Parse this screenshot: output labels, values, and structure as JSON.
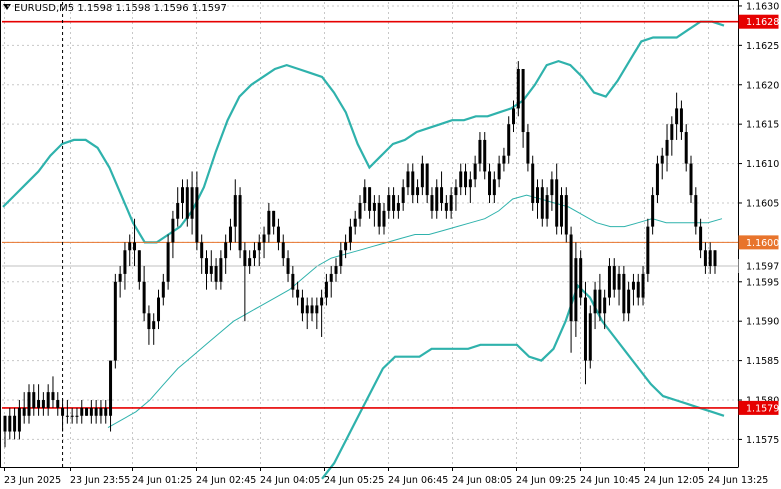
{
  "header": {
    "symbol": "EURUSD,M5",
    "ohlc": "1.1598 1.1598 1.1596 1.1597"
  },
  "chart_data": {
    "type": "candlestick",
    "ylim": [
      1.15715,
      1.16305
    ],
    "y_ticks": [
      "1.1630",
      "1.1625",
      "1.1620",
      "1.1615",
      "1.1610",
      "1.1605",
      "1.1600",
      "1.1595",
      "1.1590",
      "1.1585",
      "1.1580",
      "1.1575"
    ],
    "x_ticks": [
      "23 Jun 2025",
      "23 Jun 23:55",
      "24 Jun 01:25",
      "24 Jun 02:45",
      "24 Jun 04:05",
      "24 Jun 05:25",
      "24 Jun 06:45",
      "24 Jun 08:05",
      "24 Jun 09:25",
      "24 Jun 10:45",
      "24 Jun 12:05",
      "24 Jun 13:25"
    ],
    "grid": true,
    "horizontal_levels": [
      {
        "label": "1.1628",
        "value": 1.1628,
        "color": "#e60000",
        "badge_bg": "#e60000",
        "badge_fg": "#ffffff"
      },
      {
        "label": "1.1600",
        "value": 1.16,
        "color": "#e8742c",
        "badge_bg": "#e8742c",
        "badge_fg": "#ffffff"
      },
      {
        "label": "1.1597",
        "value": 1.1597,
        "color": "#c0c0c0",
        "badge_bg": "#ffffff",
        "badge_fg": "#000000"
      },
      {
        "label": "1.1579",
        "value": 1.1579,
        "color": "#e60000",
        "badge_bg": "#e60000",
        "badge_fg": "#ffffff"
      }
    ],
    "vertical_marker_index": 12,
    "colors": {
      "candle": "#000000",
      "band": "#2fb2ac",
      "mid": "#3cc0c0",
      "grid": "#c8c8c8",
      "axis": "#000000"
    },
    "candles": [
      [
        1.1578,
        1.1578,
        1.1574,
        1.1576
      ],
      [
        1.1576,
        1.1579,
        1.1575,
        1.1578
      ],
      [
        1.1578,
        1.1579,
        1.1575,
        1.1576
      ],
      [
        1.1576,
        1.158,
        1.1575,
        1.1579
      ],
      [
        1.1579,
        1.1581,
        1.1577,
        1.1578
      ],
      [
        1.1578,
        1.1582,
        1.1577,
        1.1581
      ],
      [
        1.1581,
        1.1582,
        1.1578,
        1.1579
      ],
      [
        1.1579,
        1.1582,
        1.1578,
        1.158
      ],
      [
        1.158,
        1.1581,
        1.1578,
        1.1579
      ],
      [
        1.1579,
        1.1582,
        1.1578,
        1.1581
      ],
      [
        1.1581,
        1.1583,
        1.1579,
        1.158
      ],
      [
        1.158,
        1.1581,
        1.1578,
        1.1579
      ],
      [
        1.1579,
        1.158,
        1.1576,
        1.1578
      ],
      [
        1.1578,
        1.158,
        1.1577,
        1.1578
      ],
      [
        1.1578,
        1.1579,
        1.1577,
        1.1578
      ],
      [
        1.1578,
        1.1579,
        1.1577,
        1.1578
      ],
      [
        1.1578,
        1.158,
        1.1577,
        1.1579
      ],
      [
        1.1579,
        1.1579,
        1.1578,
        1.1578
      ],
      [
        1.1578,
        1.158,
        1.1577,
        1.1579
      ],
      [
        1.1579,
        1.158,
        1.1577,
        1.1578
      ],
      [
        1.1578,
        1.158,
        1.1577,
        1.1579
      ],
      [
        1.1579,
        1.158,
        1.1577,
        1.1578
      ],
      [
        1.1578,
        1.1585,
        1.1576,
        1.1585
      ],
      [
        1.1585,
        1.1596,
        1.1584,
        1.1595
      ],
      [
        1.1595,
        1.1597,
        1.1593,
        1.1596
      ],
      [
        1.1596,
        1.16,
        1.1594,
        1.1599
      ],
      [
        1.1599,
        1.1601,
        1.1597,
        1.16
      ],
      [
        1.16,
        1.1603,
        1.1597,
        1.1599
      ],
      [
        1.1599,
        1.1599,
        1.1594,
        1.1595
      ],
      [
        1.1595,
        1.1597,
        1.159,
        1.1591
      ],
      [
        1.1591,
        1.1592,
        1.1587,
        1.1589
      ],
      [
        1.1589,
        1.1591,
        1.1587,
        1.159
      ],
      [
        1.159,
        1.1594,
        1.1589,
        1.1593
      ],
      [
        1.1593,
        1.1596,
        1.1592,
        1.1595
      ],
      [
        1.1595,
        1.1601,
        1.1594,
        1.16
      ],
      [
        1.16,
        1.1604,
        1.1598,
        1.1603
      ],
      [
        1.1603,
        1.1607,
        1.1602,
        1.1605
      ],
      [
        1.1605,
        1.1608,
        1.1603,
        1.1607
      ],
      [
        1.1607,
        1.1608,
        1.1602,
        1.1603
      ],
      [
        1.1603,
        1.1609,
        1.1601,
        1.1607
      ],
      [
        1.1607,
        1.1609,
        1.1599,
        1.16
      ],
      [
        1.16,
        1.1601,
        1.1596,
        1.1598
      ],
      [
        1.1598,
        1.1599,
        1.1594,
        1.1596
      ],
      [
        1.1596,
        1.1599,
        1.1595,
        1.1597
      ],
      [
        1.1597,
        1.1598,
        1.1594,
        1.1595
      ],
      [
        1.1595,
        1.1599,
        1.1594,
        1.1598
      ],
      [
        1.1598,
        1.1601,
        1.1596,
        1.16
      ],
      [
        1.16,
        1.1603,
        1.1599,
        1.1602
      ],
      [
        1.1602,
        1.1608,
        1.16,
        1.1606
      ],
      [
        1.1606,
        1.1607,
        1.1598,
        1.1599
      ],
      [
        1.1599,
        1.16,
        1.159,
        1.1597
      ],
      [
        1.1597,
        1.1599,
        1.1596,
        1.1598
      ],
      [
        1.1598,
        1.16,
        1.1597,
        1.1599
      ],
      [
        1.1599,
        1.1601,
        1.1597,
        1.16
      ],
      [
        1.16,
        1.1602,
        1.1598,
        1.1601
      ],
      [
        1.1601,
        1.1605,
        1.16,
        1.1604
      ],
      [
        1.1604,
        1.1604,
        1.1601,
        1.1602
      ],
      [
        1.1602,
        1.1603,
        1.1599,
        1.16
      ],
      [
        1.16,
        1.1601,
        1.1597,
        1.1598
      ],
      [
        1.1598,
        1.1599,
        1.1595,
        1.1596
      ],
      [
        1.1596,
        1.1597,
        1.1593,
        1.1594
      ],
      [
        1.1594,
        1.1595,
        1.1592,
        1.1593
      ],
      [
        1.1593,
        1.1594,
        1.159,
        1.1591
      ],
      [
        1.1591,
        1.1593,
        1.1589,
        1.1592
      ],
      [
        1.1592,
        1.1593,
        1.159,
        1.1591
      ],
      [
        1.1591,
        1.1593,
        1.1589,
        1.1592
      ],
      [
        1.1592,
        1.1594,
        1.1588,
        1.1593
      ],
      [
        1.1593,
        1.1596,
        1.1592,
        1.1595
      ],
      [
        1.1595,
        1.1597,
        1.1593,
        1.1596
      ],
      [
        1.1596,
        1.1598,
        1.1595,
        1.1597
      ],
      [
        1.1597,
        1.16,
        1.1596,
        1.1599
      ],
      [
        1.1599,
        1.1601,
        1.1598,
        1.16
      ],
      [
        1.16,
        1.1603,
        1.1599,
        1.1602
      ],
      [
        1.1602,
        1.1604,
        1.1601,
        1.1603
      ],
      [
        1.1603,
        1.1606,
        1.1602,
        1.1605
      ],
      [
        1.1605,
        1.1608,
        1.1604,
        1.1607
      ],
      [
        1.1607,
        1.1607,
        1.1603,
        1.1604
      ],
      [
        1.1604,
        1.1606,
        1.1602,
        1.1605
      ],
      [
        1.1605,
        1.1606,
        1.1601,
        1.1602
      ],
      [
        1.1602,
        1.1605,
        1.1601,
        1.1604
      ],
      [
        1.1604,
        1.1607,
        1.1603,
        1.1606
      ],
      [
        1.1606,
        1.1607,
        1.1603,
        1.1604
      ],
      [
        1.1604,
        1.1606,
        1.1603,
        1.1605
      ],
      [
        1.1605,
        1.1608,
        1.1604,
        1.1607
      ],
      [
        1.1607,
        1.161,
        1.1606,
        1.1609
      ],
      [
        1.1609,
        1.161,
        1.1605,
        1.1606
      ],
      [
        1.1606,
        1.1608,
        1.1605,
        1.1607
      ],
      [
        1.1607,
        1.1611,
        1.1606,
        1.161
      ],
      [
        1.161,
        1.161,
        1.1605,
        1.1606
      ],
      [
        1.1606,
        1.1607,
        1.1603,
        1.1604
      ],
      [
        1.1604,
        1.1608,
        1.1603,
        1.1607
      ],
      [
        1.1607,
        1.1609,
        1.1604,
        1.1605
      ],
      [
        1.1605,
        1.1606,
        1.1603,
        1.1604
      ],
      [
        1.1604,
        1.1607,
        1.1603,
        1.1606
      ],
      [
        1.1606,
        1.1608,
        1.1604,
        1.1607
      ],
      [
        1.1607,
        1.161,
        1.1606,
        1.1609
      ],
      [
        1.1609,
        1.161,
        1.1606,
        1.1607
      ],
      [
        1.1607,
        1.1609,
        1.1605,
        1.1608
      ],
      [
        1.1608,
        1.1611,
        1.1607,
        1.161
      ],
      [
        1.161,
        1.1614,
        1.1609,
        1.1613
      ],
      [
        1.1613,
        1.1614,
        1.1608,
        1.1609
      ],
      [
        1.1609,
        1.161,
        1.1605,
        1.1606
      ],
      [
        1.1606,
        1.1609,
        1.1605,
        1.1608
      ],
      [
        1.1608,
        1.1611,
        1.1607,
        1.161
      ],
      [
        1.161,
        1.1612,
        1.1609,
        1.1611
      ],
      [
        1.1611,
        1.1616,
        1.161,
        1.1615
      ],
      [
        1.1615,
        1.1618,
        1.1614,
        1.1617
      ],
      [
        1.1617,
        1.1623,
        1.1616,
        1.1622
      ],
      [
        1.1622,
        1.1622,
        1.1612,
        1.1614
      ],
      [
        1.1614,
        1.1615,
        1.1609,
        1.161
      ],
      [
        1.161,
        1.1611,
        1.1604,
        1.1605
      ],
      [
        1.1605,
        1.1608,
        1.1603,
        1.1607
      ],
      [
        1.1607,
        1.1608,
        1.1602,
        1.1603
      ],
      [
        1.1603,
        1.1607,
        1.1602,
        1.1606
      ],
      [
        1.1606,
        1.1609,
        1.1604,
        1.1608
      ],
      [
        1.1608,
        1.161,
        1.1601,
        1.1602
      ],
      [
        1.1602,
        1.1607,
        1.1601,
        1.1606
      ],
      [
        1.1606,
        1.1607,
        1.16,
        1.1601
      ],
      [
        1.1601,
        1.1602,
        1.1586,
        1.159
      ],
      [
        1.159,
        1.16,
        1.1588,
        1.1598
      ],
      [
        1.1598,
        1.1599,
        1.1592,
        1.1593
      ],
      [
        1.1593,
        1.1595,
        1.1582,
        1.1585
      ],
      [
        1.1585,
        1.1592,
        1.1584,
        1.1591
      ],
      [
        1.1591,
        1.1595,
        1.1589,
        1.1594
      ],
      [
        1.1594,
        1.1596,
        1.159,
        1.1591
      ],
      [
        1.1591,
        1.1594,
        1.1589,
        1.1593
      ],
      [
        1.1593,
        1.1598,
        1.1592,
        1.1597
      ],
      [
        1.1597,
        1.1598,
        1.1593,
        1.1594
      ],
      [
        1.1594,
        1.1597,
        1.1592,
        1.1596
      ],
      [
        1.1596,
        1.1597,
        1.159,
        1.1591
      ],
      [
        1.1591,
        1.1595,
        1.159,
        1.1594
      ],
      [
        1.1594,
        1.1596,
        1.1592,
        1.1595
      ],
      [
        1.1595,
        1.1596,
        1.1592,
        1.1593
      ],
      [
        1.1593,
        1.1597,
        1.1592,
        1.1596
      ],
      [
        1.1596,
        1.1603,
        1.1595,
        1.1602
      ],
      [
        1.1602,
        1.1607,
        1.1601,
        1.1606
      ],
      [
        1.1606,
        1.1611,
        1.1605,
        1.161
      ],
      [
        1.161,
        1.1612,
        1.1608,
        1.1611
      ],
      [
        1.1611,
        1.1615,
        1.1609,
        1.1613
      ],
      [
        1.1613,
        1.1616,
        1.1611,
        1.1615
      ],
      [
        1.1615,
        1.1619,
        1.1613,
        1.1617
      ],
      [
        1.1617,
        1.1618,
        1.1613,
        1.1614
      ],
      [
        1.1614,
        1.1615,
        1.1609,
        1.161
      ],
      [
        1.161,
        1.1611,
        1.1605,
        1.1606
      ],
      [
        1.1606,
        1.1607,
        1.1601,
        1.1602
      ],
      [
        1.1602,
        1.1603,
        1.1598,
        1.1599
      ],
      [
        1.1599,
        1.16,
        1.1596,
        1.1597
      ],
      [
        1.1597,
        1.16,
        1.1596,
        1.1599
      ],
      [
        1.1599,
        1.1599,
        1.1596,
        1.1597
      ]
    ],
    "band_upper": [
      1.16045,
      1.1606,
      1.16075,
      1.1609,
      1.1611,
      1.16125,
      1.1613,
      1.1613,
      1.1612,
      1.16095,
      1.1606,
      1.16025,
      1.16,
      1.16,
      1.1601,
      1.1602,
      1.1604,
      1.1607,
      1.16115,
      1.16155,
      1.16185,
      1.162,
      1.1621,
      1.1622,
      1.16225,
      1.1622,
      1.16215,
      1.1621,
      1.1619,
      1.16165,
      1.16125,
      1.16095,
      1.1611,
      1.16125,
      1.1613,
      1.1614,
      1.16145,
      1.1615,
      1.16155,
      1.16155,
      1.1616,
      1.1616,
      1.16165,
      1.1617,
      1.1618,
      1.162,
      1.16225,
      1.1623,
      1.16225,
      1.1621,
      1.1619,
      1.16185,
      1.16205,
      1.1623,
      1.16255,
      1.1626,
      1.1626,
      1.1626,
      1.1627,
      1.1628,
      1.1628,
      1.16275
    ],
    "band_mid": [
      1.15765,
      1.15775,
      1.15785,
      1.158,
      1.1582,
      1.1584,
      1.15855,
      1.1587,
      1.15885,
      1.159,
      1.1591,
      1.1592,
      1.1593,
      1.1594,
      1.15955,
      1.1597,
      1.1598,
      1.15985,
      1.1599,
      1.15995,
      1.16,
      1.16005,
      1.1601,
      1.1601,
      1.16015,
      1.1602,
      1.16025,
      1.1603,
      1.1604,
      1.16055,
      1.1606,
      1.16055,
      1.1605,
      1.16045,
      1.16035,
      1.16025,
      1.1602,
      1.1602,
      1.16025,
      1.1603,
      1.16025,
      1.16025,
      1.16025,
      1.16025,
      1.1603
    ],
    "band_lower": [
      1.157,
      1.1572,
      1.1575,
      1.1578,
      1.1581,
      1.1584,
      1.15855,
      1.15855,
      1.15855,
      1.15865,
      1.15865,
      1.15865,
      1.15865,
      1.1587,
      1.1587,
      1.1587,
      1.1587,
      1.15855,
      1.1585,
      1.15865,
      1.159,
      1.15945,
      1.1593,
      1.159,
      1.1588,
      1.1586,
      1.1584,
      1.1582,
      1.15805,
      1.158,
      1.15795,
      1.1579,
      1.15785,
      1.1578
    ]
  }
}
